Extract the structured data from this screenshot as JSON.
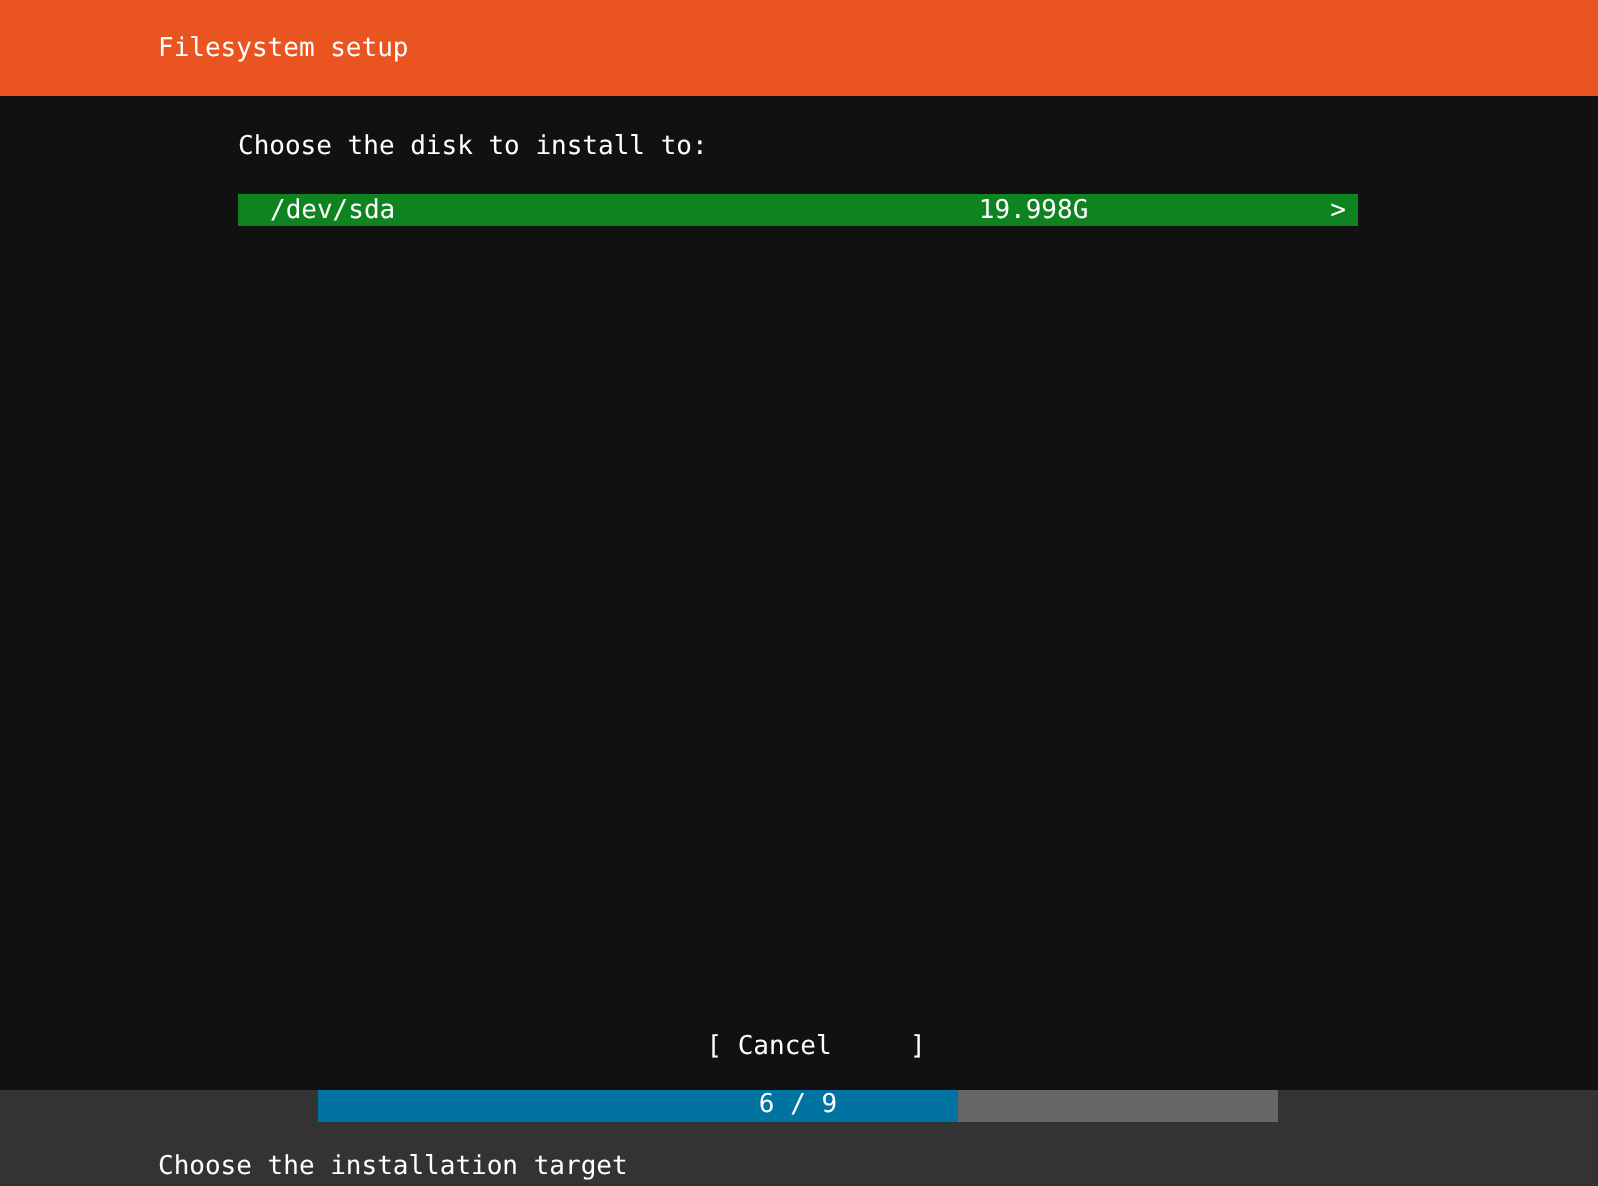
{
  "header": {
    "title": "Filesystem setup"
  },
  "prompt": "Choose the disk to install to:",
  "disks": [
    {
      "name": "/dev/sda",
      "size": "19.998G",
      "arrow": ">",
      "selected": true
    }
  ],
  "buttons": [
    {
      "label": "[ Cancel     ]"
    }
  ],
  "progress": {
    "label": "6 / 9",
    "level": 0.667
  },
  "status_bar": {
    "text": "Choose the installation target"
  }
}
